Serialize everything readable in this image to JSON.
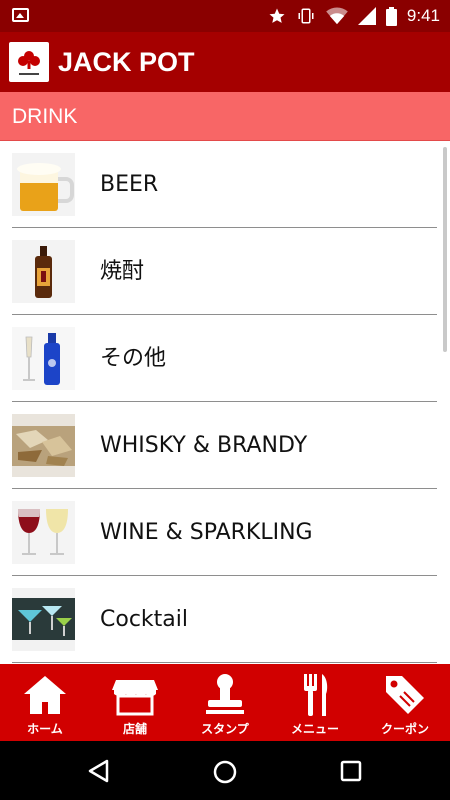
{
  "status_bar": {
    "time": "9:41",
    "icons": [
      "image-notification-icon",
      "star-icon",
      "vibrate-icon",
      "wifi-icon",
      "signal-icon",
      "battery-icon"
    ]
  },
  "app_bar": {
    "title": "JACK POT",
    "logo_icon": "jackpot-logo-icon"
  },
  "section": {
    "title": "DRINK"
  },
  "list": {
    "items": [
      {
        "label": "BEER",
        "thumb": "beer-mug-photo"
      },
      {
        "label": "焼酎",
        "thumb": "shochu-bottle-photo"
      },
      {
        "label": "その他",
        "thumb": "sake-bottles-photo"
      },
      {
        "label": "WHISKY & BRANDY",
        "thumb": "whisky-glass-photo"
      },
      {
        "label": "WINE & SPARKLING",
        "thumb": "wine-glasses-photo"
      },
      {
        "label": "Cocktail",
        "thumb": "cocktail-glasses-photo"
      }
    ]
  },
  "tabs": [
    {
      "label": "ホーム",
      "icon": "home-icon"
    },
    {
      "label": "店舗",
      "icon": "store-icon"
    },
    {
      "label": "スタンプ",
      "icon": "stamp-icon"
    },
    {
      "label": "メニュー",
      "icon": "fork-knife-icon"
    },
    {
      "label": "クーポン",
      "icon": "coupon-tag-icon"
    }
  ],
  "colors": {
    "status_bar": "#8a0000",
    "app_bar": "#a50000",
    "section_header": "#f86666",
    "tab_bar": "#d10000"
  }
}
